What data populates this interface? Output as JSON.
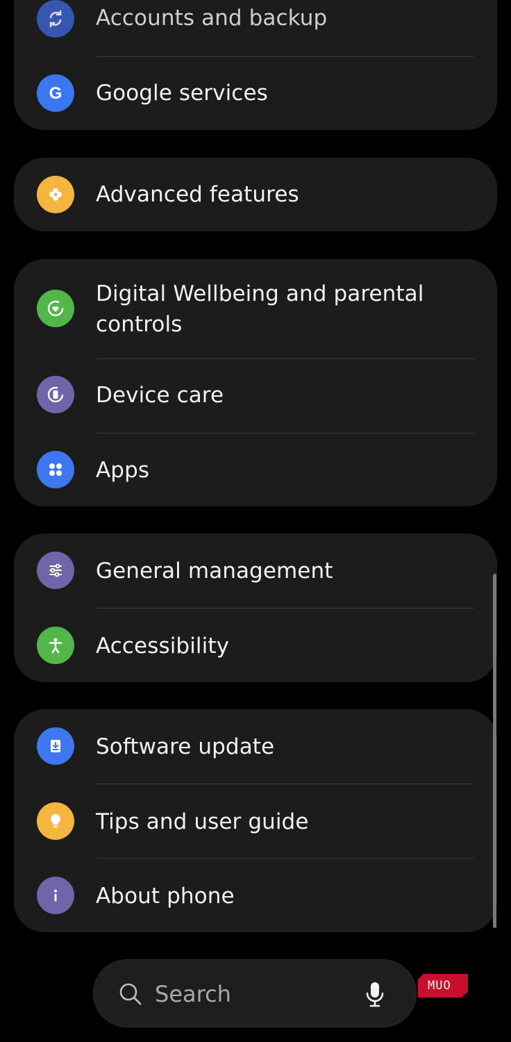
{
  "settings_groups": [
    {
      "items": [
        {
          "label": "Accounts and backup",
          "icon": "sync-icon",
          "color": "#3a62c9"
        },
        {
          "label": "Google services",
          "icon": "google-icon",
          "color": "#3b78f0"
        }
      ]
    },
    {
      "items": [
        {
          "label": "Advanced features",
          "icon": "puzzle-gear-icon",
          "color": "#f5b63f"
        }
      ]
    },
    {
      "items": [
        {
          "label": "Digital Wellbeing and parental controls",
          "icon": "wellbeing-heart-icon",
          "color": "#52b64a"
        },
        {
          "label": "Device care",
          "icon": "device-care-icon",
          "color": "#6f65a8"
        },
        {
          "label": "Apps",
          "icon": "apps-grid-icon",
          "color": "#3e77ef"
        }
      ]
    },
    {
      "items": [
        {
          "label": "General management",
          "icon": "sliders-icon",
          "color": "#6f65a8"
        },
        {
          "label": "Accessibility",
          "icon": "accessibility-person-icon",
          "color": "#52b64a"
        }
      ]
    },
    {
      "items": [
        {
          "label": "Software update",
          "icon": "download-icon",
          "color": "#3e77ef"
        },
        {
          "label": "Tips and user guide",
          "icon": "lightbulb-icon",
          "color": "#f5b63f"
        },
        {
          "label": "About phone",
          "icon": "info-icon",
          "color": "#6f65a8"
        }
      ]
    }
  ],
  "search": {
    "placeholder": "Search",
    "icon": "search-icon",
    "mic_icon": "microphone-icon"
  },
  "watermark": {
    "text": "MUO",
    "color": "#c8102e"
  }
}
